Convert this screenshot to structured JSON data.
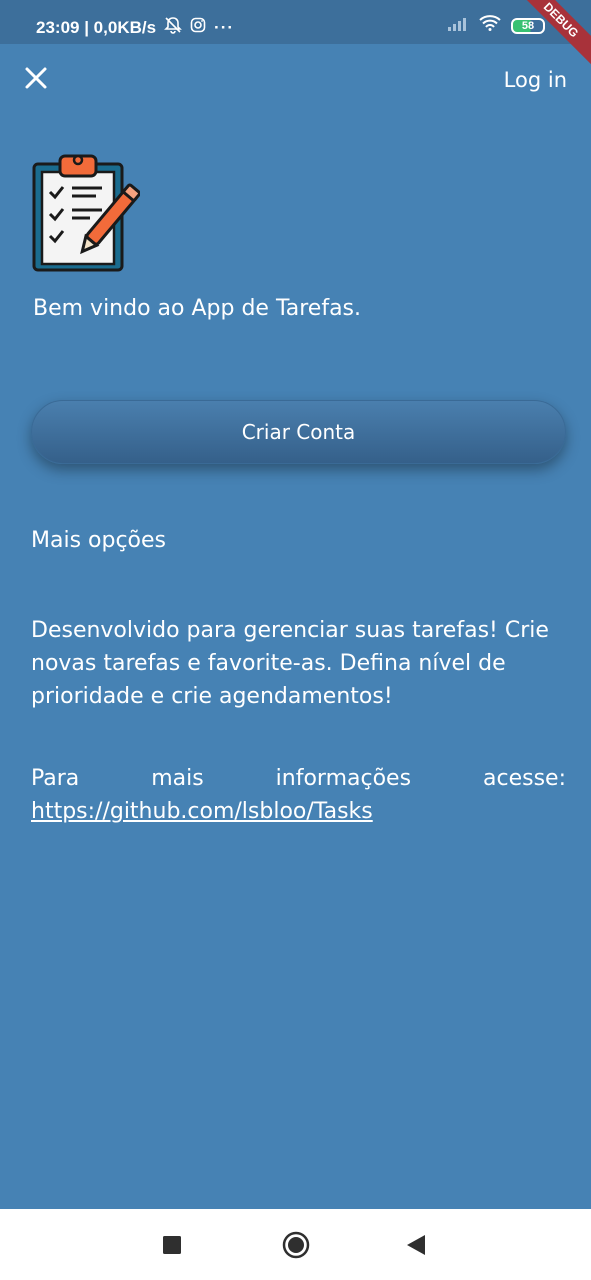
{
  "status_bar": {
    "time_speed": "23:09 | 0,0KB/s",
    "dots": "···",
    "battery": "58",
    "debug": "DEBUG"
  },
  "app_bar": {
    "login_label": "Log in"
  },
  "welcome": "Bem vindo ao App de Tarefas.",
  "create_account_label": "Criar Conta",
  "more_options_label": "Mais opções",
  "description": "Desenvolvido para gerenciar suas tarefas! Crie novas tarefas e favorite-as. Defina nível de prioridade e crie agendamentos!",
  "info": {
    "words": [
      "Para",
      "mais",
      "informações",
      "acesse:"
    ],
    "link": "https://github.com/lsbloo/Tasks"
  },
  "colors": {
    "background": "#4682b4",
    "status_bar": "#3d6f9b",
    "button": "#35608a",
    "clipboard_orange": "#f26b3a"
  },
  "icons": {
    "close": "close-icon",
    "logo": "clipboard-checklist-icon",
    "nav_square": "recents-square-icon",
    "nav_circle": "home-circle-icon",
    "nav_back": "back-triangle-icon"
  }
}
